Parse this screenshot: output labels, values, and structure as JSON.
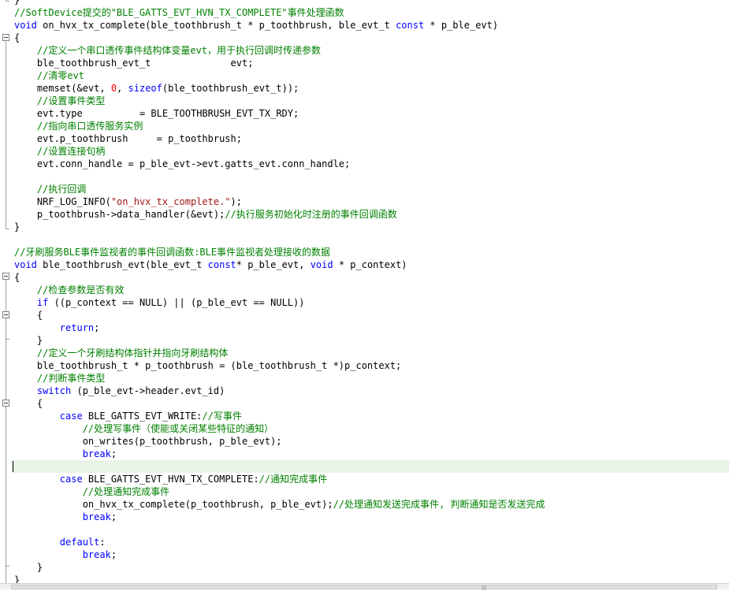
{
  "lines": [
    [
      [
        "txt",
        "}"
      ]
    ],
    [
      [
        "cm",
        "//SoftDevice提交的\"BLE_GATTS_EVT_HVN_TX_COMPLETE\"事件处理函数"
      ]
    ],
    [
      [
        "kw",
        "void"
      ],
      [
        "txt",
        " on_hvx_tx_complete(ble_toothbrush_t * p_toothbrush, ble_evt_t "
      ],
      [
        "kw",
        "const"
      ],
      [
        "txt",
        " * p_ble_evt)"
      ]
    ],
    [
      [
        "txt",
        "{"
      ]
    ],
    [
      [
        "txt",
        "    "
      ],
      [
        "cm",
        "//定义一个串口透传事件结构体变量evt，用于执行回调时传递参数"
      ]
    ],
    [
      [
        "txt",
        "    ble_toothbrush_evt_t              evt;"
      ]
    ],
    [
      [
        "txt",
        "    "
      ],
      [
        "cm",
        "//清零evt"
      ]
    ],
    [
      [
        "txt",
        "    memset(&evt, "
      ],
      [
        "num",
        "0"
      ],
      [
        "txt",
        ", "
      ],
      [
        "kw",
        "sizeof"
      ],
      [
        "txt",
        "(ble_toothbrush_evt_t));"
      ]
    ],
    [
      [
        "txt",
        "    "
      ],
      [
        "cm",
        "//设置事件类型"
      ]
    ],
    [
      [
        "txt",
        "    evt.type          = BLE_TOOTHBRUSH_EVT_TX_RDY;"
      ]
    ],
    [
      [
        "txt",
        "    "
      ],
      [
        "cm",
        "//指向串口透传服务实例"
      ]
    ],
    [
      [
        "txt",
        "    evt.p_toothbrush     = p_toothbrush;"
      ]
    ],
    [
      [
        "txt",
        "    "
      ],
      [
        "cm",
        "//设置连接句柄"
      ]
    ],
    [
      [
        "txt",
        "    evt.conn_handle = p_ble_evt->evt.gatts_evt.conn_handle;"
      ]
    ],
    [],
    [
      [
        "txt",
        "    "
      ],
      [
        "cm",
        "//执行回调"
      ]
    ],
    [
      [
        "txt",
        "    NRF_LOG_INFO("
      ],
      [
        "str",
        "\"on_hvx_tx_complete.\""
      ],
      [
        "txt",
        ");"
      ]
    ],
    [
      [
        "txt",
        "    p_toothbrush->data_handler(&evt);"
      ],
      [
        "cm",
        "//执行服务初始化时注册的事件回调函数"
      ]
    ],
    [
      [
        "txt",
        "}"
      ]
    ],
    [],
    [
      [
        "cm",
        "//牙刷服务BLE事件监视者的事件回调函数:BLE事件监视者处理接收的数据"
      ]
    ],
    [
      [
        "kw",
        "void"
      ],
      [
        "txt",
        " ble_toothbrush_evt(ble_evt_t "
      ],
      [
        "kw",
        "const"
      ],
      [
        "txt",
        "* p_ble_evt, "
      ],
      [
        "kw",
        "void"
      ],
      [
        "txt",
        " * p_context)"
      ]
    ],
    [
      [
        "txt",
        "{"
      ]
    ],
    [
      [
        "txt",
        "    "
      ],
      [
        "cm",
        "//检查参数是否有效"
      ]
    ],
    [
      [
        "txt",
        "    "
      ],
      [
        "kw",
        "if"
      ],
      [
        "txt",
        " ((p_context == NULL) || (p_ble_evt == NULL))"
      ]
    ],
    [
      [
        "txt",
        "    {"
      ]
    ],
    [
      [
        "txt",
        "        "
      ],
      [
        "kw",
        "return"
      ],
      [
        "txt",
        ";"
      ]
    ],
    [
      [
        "txt",
        "    }"
      ]
    ],
    [
      [
        "txt",
        "    "
      ],
      [
        "cm",
        "//定义一个牙刷结构体指针并指向牙刷结构体"
      ]
    ],
    [
      [
        "txt",
        "    ble_toothbrush_t * p_toothbrush = (ble_toothbrush_t *)p_context;"
      ]
    ],
    [
      [
        "txt",
        "    "
      ],
      [
        "cm",
        "//判断事件类型"
      ]
    ],
    [
      [
        "txt",
        "    "
      ],
      [
        "kw",
        "switch"
      ],
      [
        "txt",
        " (p_ble_evt->header.evt_id)"
      ]
    ],
    [
      [
        "txt",
        "    {"
      ]
    ],
    [
      [
        "txt",
        "        "
      ],
      [
        "kw",
        "case"
      ],
      [
        "txt",
        " BLE_GATTS_EVT_WRITE:"
      ],
      [
        "cm",
        "//写事件"
      ]
    ],
    [
      [
        "txt",
        "            "
      ],
      [
        "cm",
        "//处理写事件（使能或关闭某些特征的通知）"
      ]
    ],
    [
      [
        "txt",
        "            on_writes(p_toothbrush, p_ble_evt);"
      ]
    ],
    [
      [
        "txt",
        "            "
      ],
      [
        "kw",
        "break"
      ],
      [
        "txt",
        ";"
      ]
    ],
    [],
    [
      [
        "txt",
        "        "
      ],
      [
        "kw",
        "case"
      ],
      [
        "txt",
        " BLE_GATTS_EVT_HVN_TX_COMPLETE:"
      ],
      [
        "cm",
        "//通知完成事件"
      ]
    ],
    [
      [
        "txt",
        "            "
      ],
      [
        "cm",
        "//处理通知完成事件"
      ]
    ],
    [
      [
        "txt",
        "            on_hvx_tx_complete(p_toothbrush, p_ble_evt);"
      ],
      [
        "cm",
        "//处理通知发送完成事件, 判断通知是否发送完成"
      ]
    ],
    [
      [
        "txt",
        "            "
      ],
      [
        "kw",
        "break"
      ],
      [
        "txt",
        ";"
      ]
    ],
    [],
    [
      [
        "txt",
        "        "
      ],
      [
        "kw",
        "default"
      ],
      [
        "txt",
        ":"
      ]
    ],
    [
      [
        "txt",
        "            "
      ],
      [
        "kw",
        "break"
      ],
      [
        "txt",
        ";"
      ]
    ],
    [
      [
        "txt",
        "    }"
      ]
    ],
    [
      [
        "txt",
        "}"
      ]
    ]
  ],
  "current_line": 37,
  "colors": {
    "comment": "#008000",
    "keyword": "#0000ff",
    "number": "#ff0000",
    "string": "#a31515",
    "text": "#000000",
    "current_line_bg": "#e8f4e8"
  },
  "scrollbar": {
    "grip_glyph": "|||"
  }
}
